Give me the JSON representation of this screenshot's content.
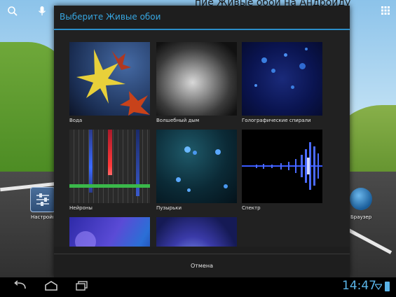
{
  "desktop": {
    "partial_text": "пие Живые обои на Андроиду",
    "settings_label": "Настройки",
    "globe_label": "Браузер"
  },
  "dialog": {
    "title": "Выберите Живые обои",
    "accent_color": "#37a6e0",
    "wallpapers": [
      {
        "label": "Вода",
        "icon": "water-thumbnail"
      },
      {
        "label": "Волшебный дым",
        "icon": "smoke-thumbnail"
      },
      {
        "label": "Голографические спирали",
        "icon": "spiral-thumbnail"
      },
      {
        "label": "Нейроны",
        "icon": "neurons-thumbnail"
      },
      {
        "label": "Пузырьки",
        "icon": "bubbles-thumbnail"
      },
      {
        "label": "Спектр",
        "icon": "spectrum-thumbnail"
      },
      {
        "label": "",
        "icon": "blue-gradient-thumbnail"
      },
      {
        "label": "",
        "icon": "light-beam-thumbnail"
      }
    ],
    "cancel_label": "Отмена"
  },
  "statusbar": {
    "time": "14:47",
    "clock_color": "#5ab4e8"
  },
  "navbar": {
    "icons": [
      "back-icon",
      "home-icon",
      "recent-apps-icon"
    ]
  }
}
